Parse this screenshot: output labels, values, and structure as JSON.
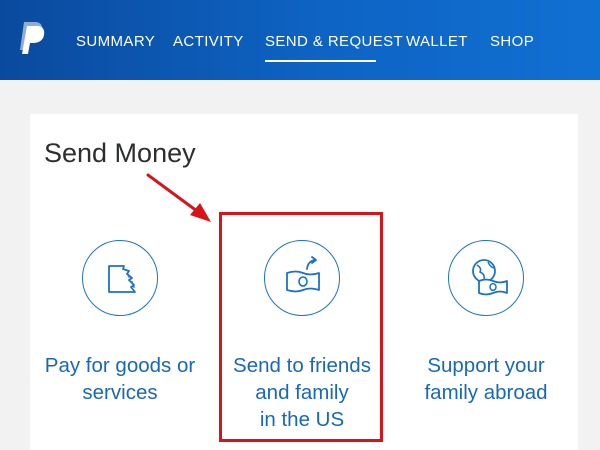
{
  "nav": {
    "logo_icon": "paypal-p-logo-icon",
    "items": [
      {
        "label": "SUMMARY"
      },
      {
        "label": "ACTIVITY"
      },
      {
        "label": "SEND & REQUEST",
        "active": true
      },
      {
        "label": "WALLET"
      },
      {
        "label": "SHOP"
      }
    ]
  },
  "main": {
    "title": "Send Money",
    "options": [
      {
        "line1": "Pay for goods or",
        "line2": "services",
        "line3": "",
        "icon": "receipt-icon"
      },
      {
        "line1": "Send to friends",
        "line2": "and family",
        "line3": "in the US",
        "icon": "money-send-icon"
      },
      {
        "line1": "Support your",
        "line2": "family abroad",
        "line3": "",
        "icon": "globe-money-icon"
      }
    ]
  },
  "annotation": {
    "arrow_icon": "red-arrow-icon",
    "color": "#d8141b"
  },
  "colors": {
    "brand": "#0e64c4",
    "accent": "#1769b8"
  }
}
